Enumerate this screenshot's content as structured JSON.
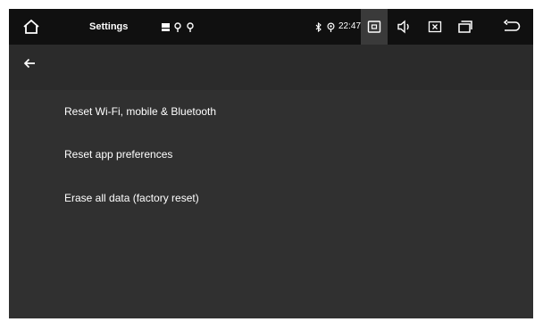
{
  "status_bar": {
    "app_title": "Settings",
    "time": "22:47",
    "icons": [
      "home-icon",
      "notification-icon",
      "location-icon",
      "bluetooth-icon",
      "gps-icon",
      "screenshot-icon",
      "volume-icon",
      "close-app-icon",
      "recent-apps-icon",
      "back-nav-icon"
    ],
    "active_button": "screenshot-button"
  },
  "toolbar": {
    "back_icon": "back-arrow-icon"
  },
  "reset_options": {
    "items": [
      {
        "label": "Reset Wi-Fi, mobile & Bluetooth"
      },
      {
        "label": "Reset app preferences"
      },
      {
        "label": "Erase all data (factory reset)"
      }
    ]
  },
  "colors": {
    "status_bar_bg": "#101010",
    "content_bg": "#303030",
    "text": "#ffffff",
    "active_button_bg": "#3a3a3a"
  }
}
